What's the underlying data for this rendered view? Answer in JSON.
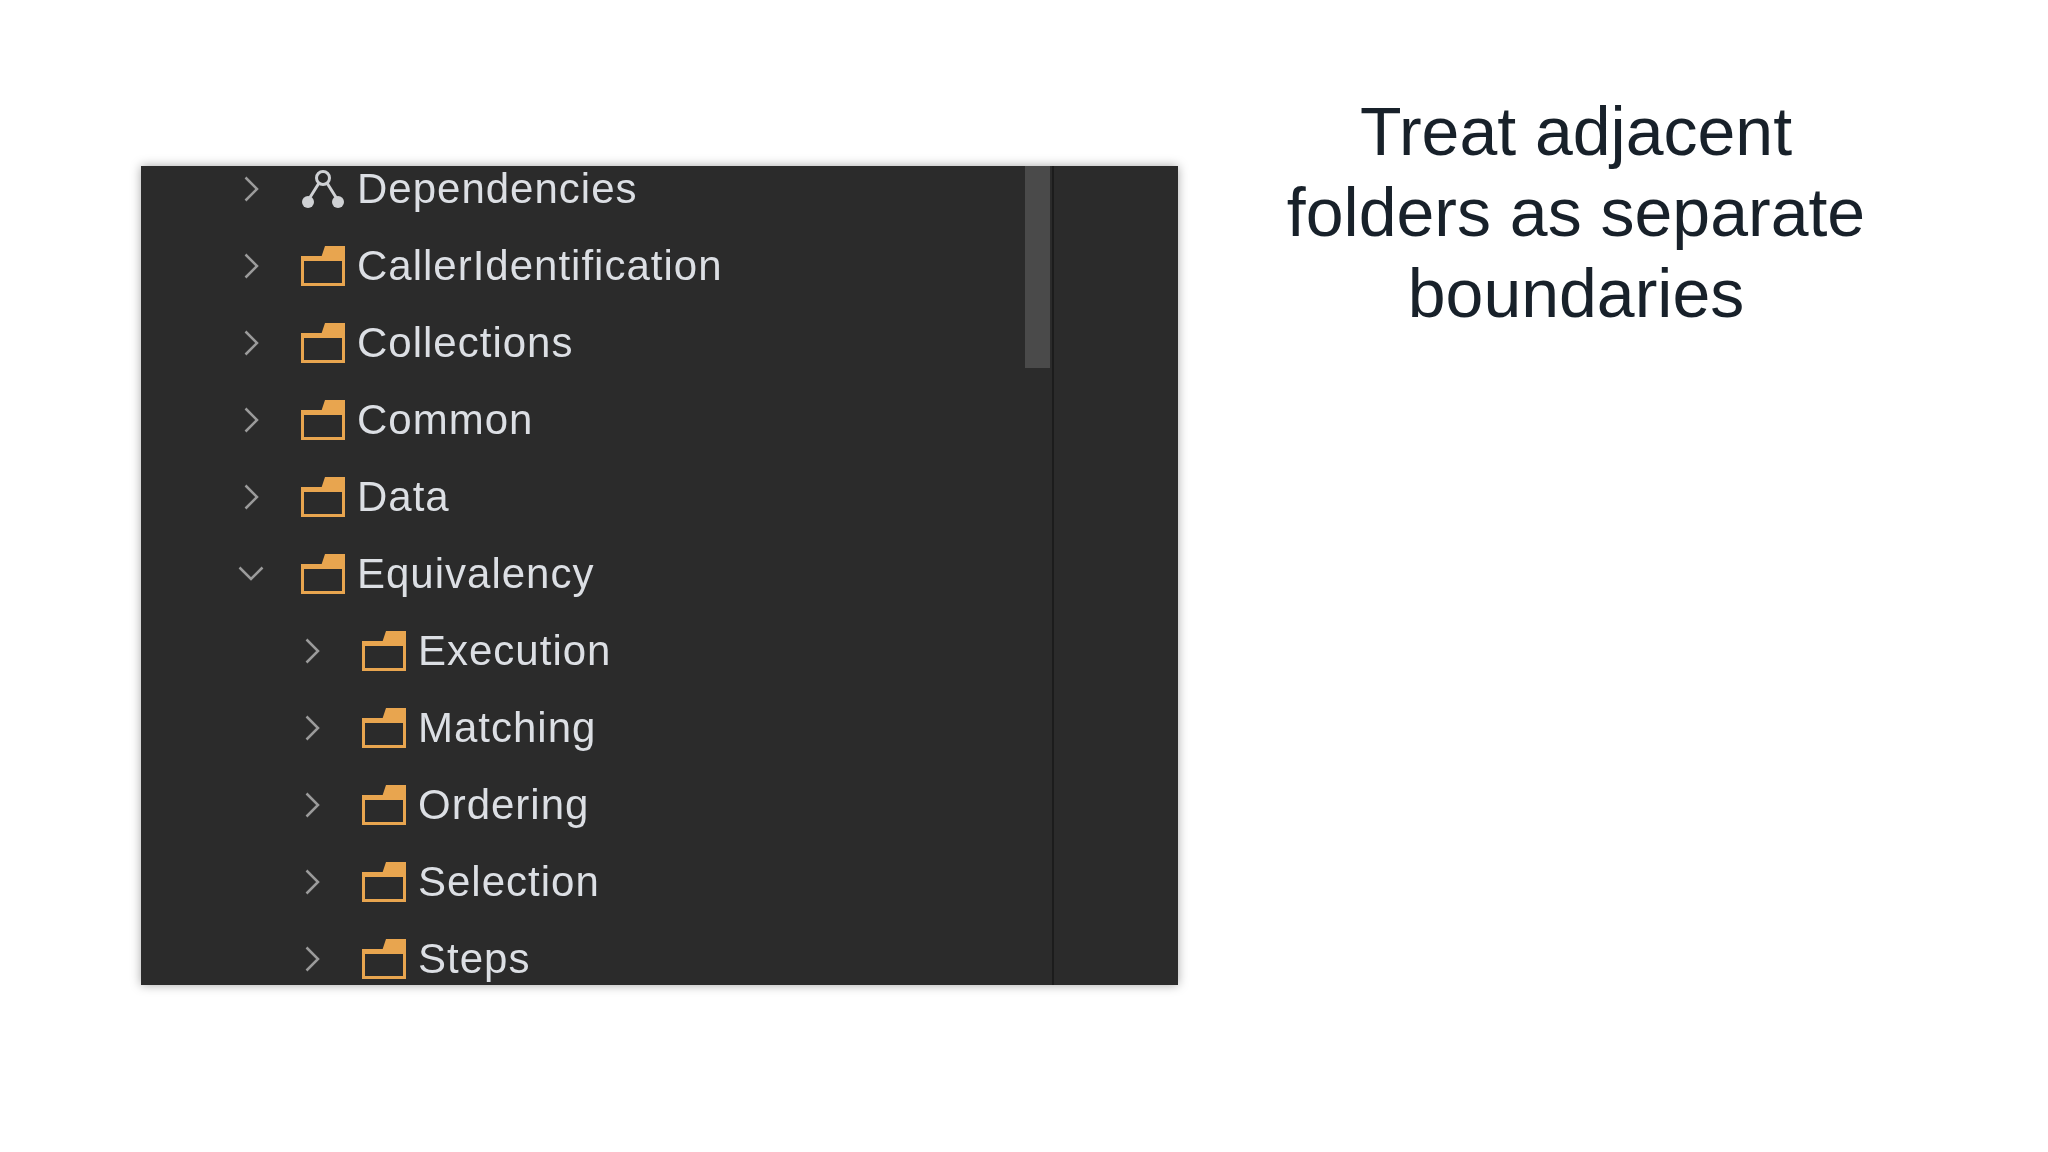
{
  "tree": {
    "items": [
      {
        "label": "Dependencies",
        "kind": "dependencies",
        "expanded": false
      },
      {
        "label": "CallerIdentification",
        "kind": "folder",
        "expanded": false
      },
      {
        "label": "Collections",
        "kind": "folder",
        "expanded": false
      },
      {
        "label": "Common",
        "kind": "folder",
        "expanded": false
      },
      {
        "label": "Data",
        "kind": "folder",
        "expanded": false
      },
      {
        "label": "Equivalency",
        "kind": "folder",
        "expanded": true,
        "children": [
          {
            "label": "Execution",
            "kind": "folder",
            "expanded": false
          },
          {
            "label": "Matching",
            "kind": "folder",
            "expanded": false
          },
          {
            "label": "Ordering",
            "kind": "folder",
            "expanded": false
          },
          {
            "label": "Selection",
            "kind": "folder",
            "expanded": false
          },
          {
            "label": "Steps",
            "kind": "folder",
            "expanded": false
          }
        ]
      }
    ]
  },
  "heading": "Treat adjacent folders as separate boundaries"
}
